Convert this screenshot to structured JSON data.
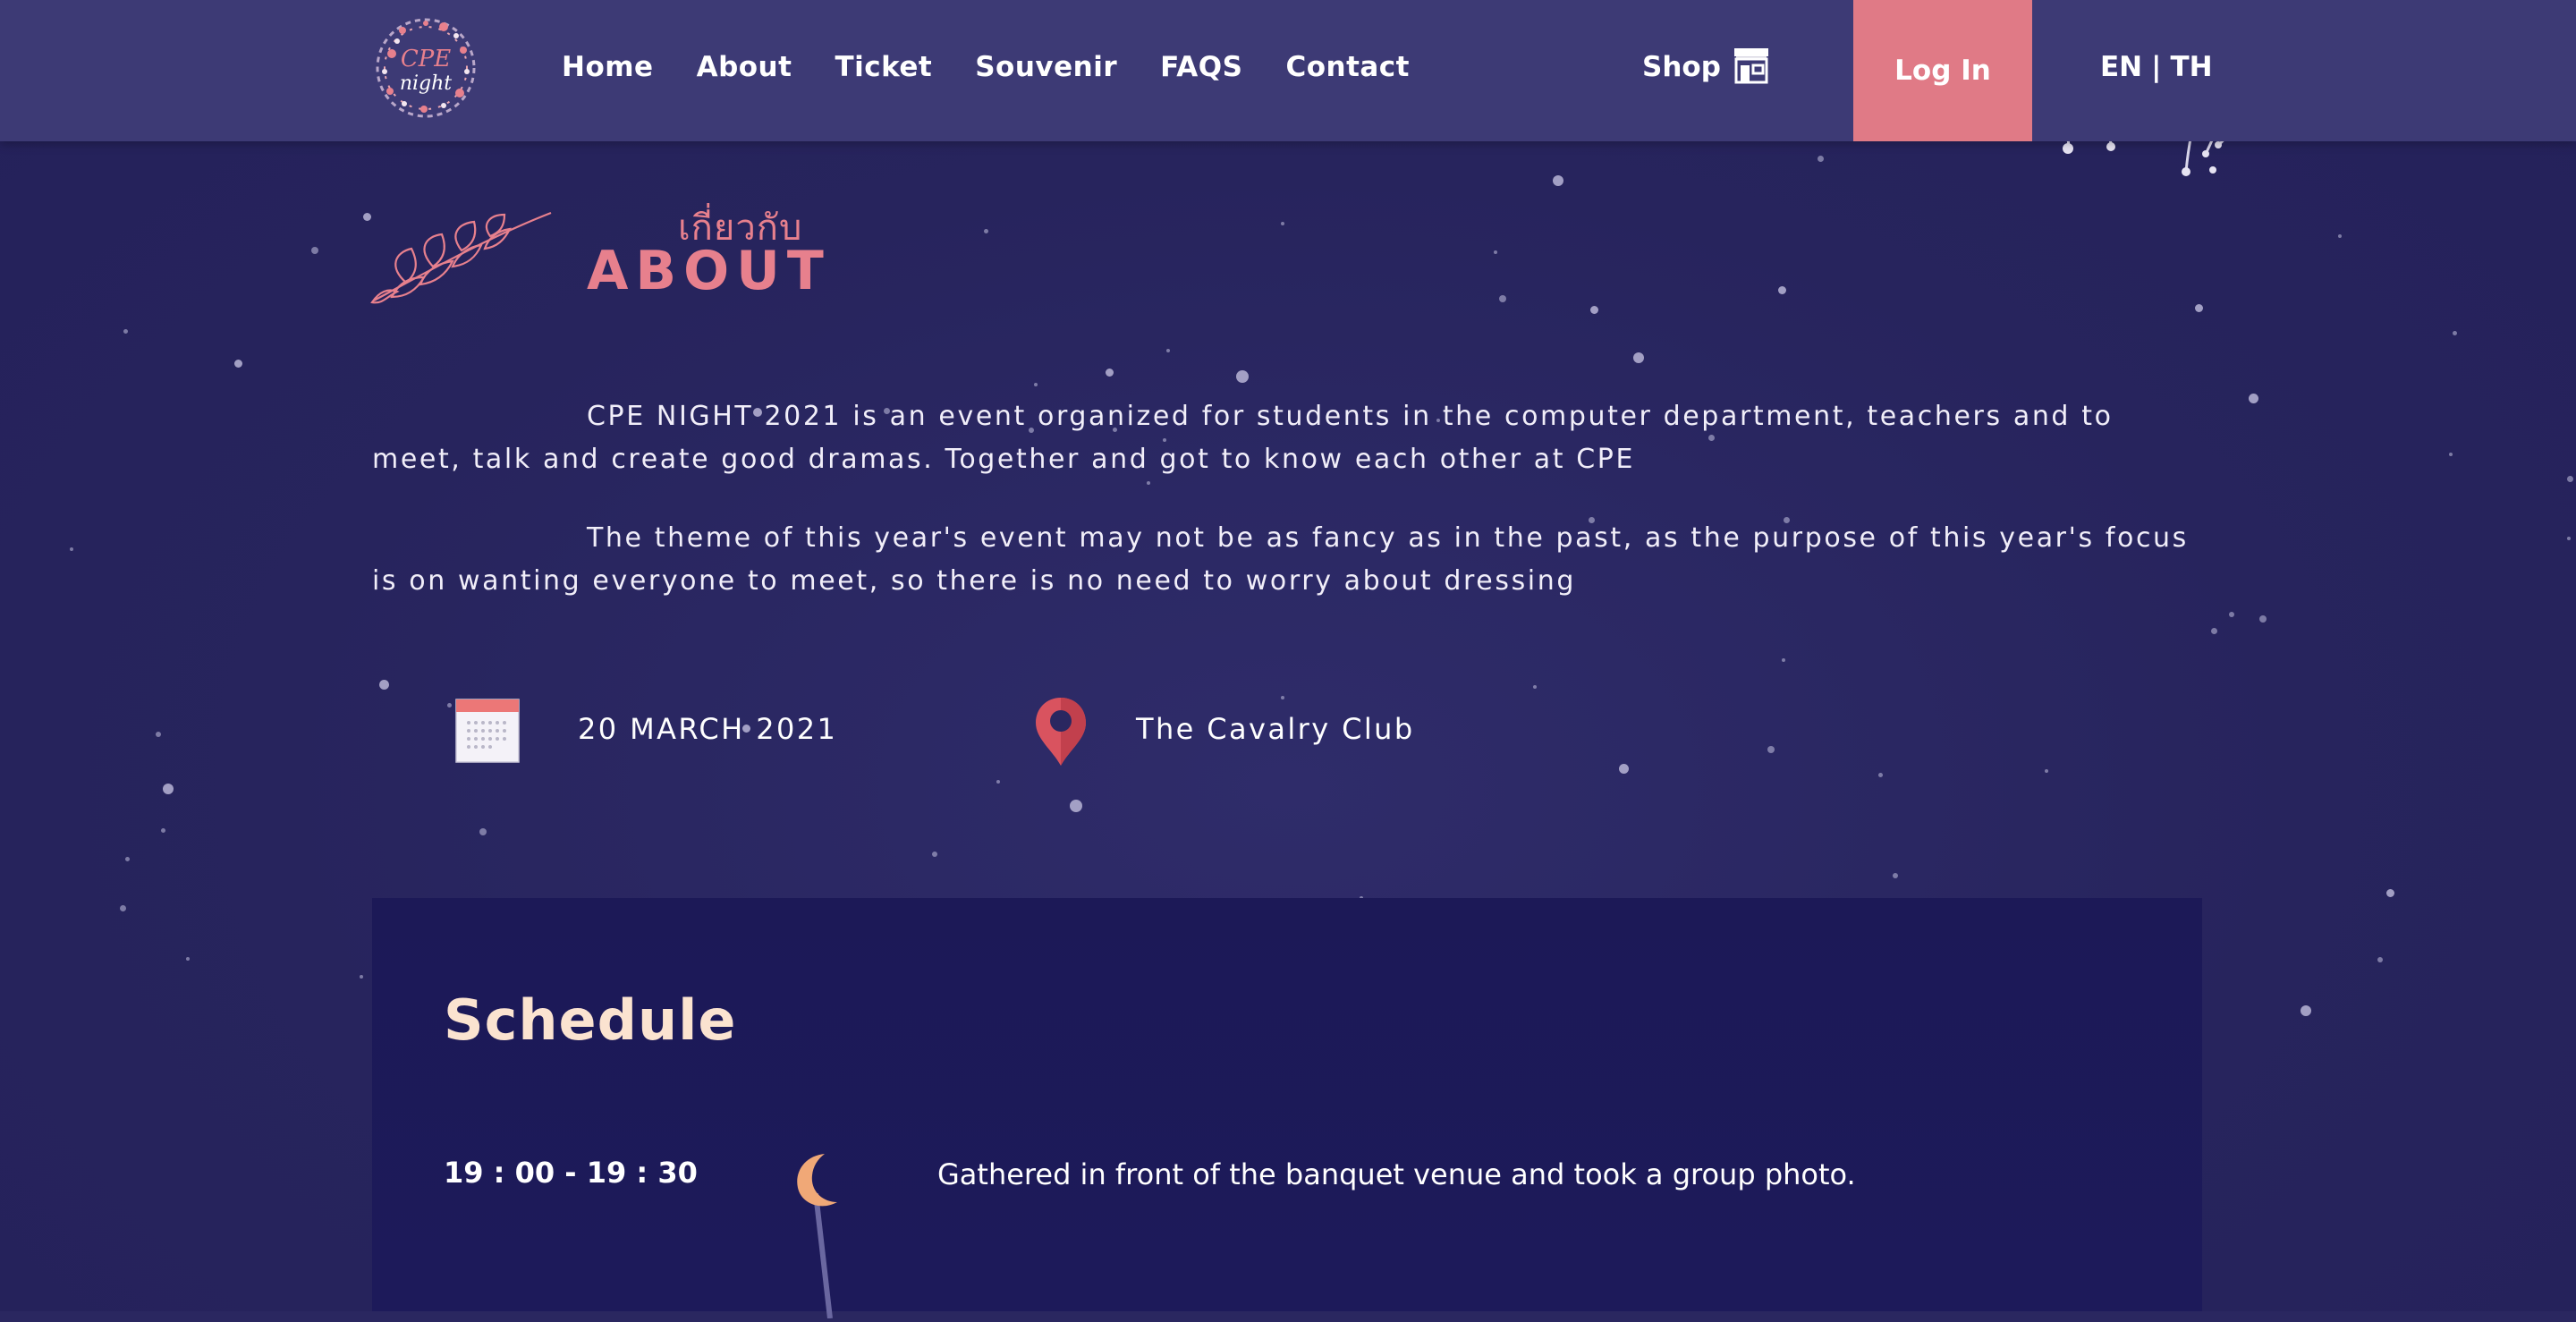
{
  "nav": {
    "logo_text": "CPE night",
    "links": [
      "Home",
      "About",
      "Ticket",
      "Souvenir",
      "FAQS",
      "Contact"
    ],
    "shop_label": "Shop",
    "login_label": "Log In",
    "lang_en": "EN",
    "lang_sep": "|",
    "lang_th": "TH"
  },
  "about": {
    "thai_heading": "เกี่ยวกับ",
    "heading": "ABOUT",
    "paragraph1": "CPE NIGHT 2021 is an event organized for students in the computer department, teachers and to meet, talk and create good dramas. Together and got to know each other at CPE",
    "paragraph2": "The theme of this year's event may not be as fancy as in the past, as the purpose of this year's focus is on wanting everyone to meet, so there is no need to worry about dressing",
    "date": "20 MARCH 2021",
    "venue": "The Cavalry Club"
  },
  "schedule": {
    "title": "Schedule",
    "items": [
      {
        "time": "19 : 00 - 19 : 30",
        "description": "Gathered in front of the banquet venue and took a group photo."
      }
    ]
  },
  "colors": {
    "background": "#2a2760",
    "navbar": "#3d3a75",
    "accent_pink": "#e07a86",
    "schedule_panel": "#1d1a58",
    "schedule_title": "#fbe3d0",
    "moon": "#f0a877"
  },
  "icons": {
    "shop": "shop-icon",
    "calendar": "calendar-icon",
    "location": "location-pin-icon",
    "leaf": "leaf-branch-icon",
    "moon": "moon-icon"
  }
}
